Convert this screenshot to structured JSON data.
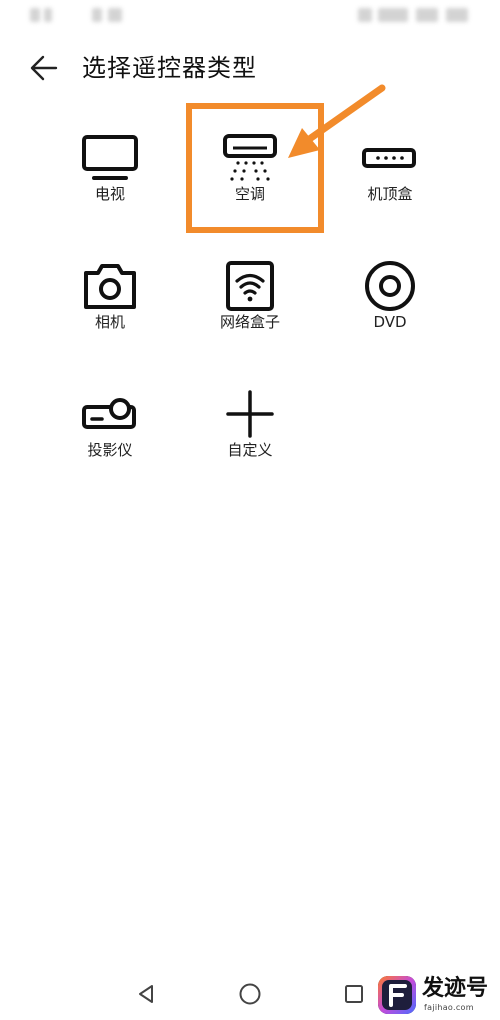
{
  "header": {
    "title": "选择遥控器类型",
    "back_icon": "arrow-left-icon"
  },
  "devices": [
    {
      "label": "电视",
      "icon": "tv-icon"
    },
    {
      "label": "空调",
      "icon": "air-conditioner-icon"
    },
    {
      "label": "机顶盒",
      "icon": "set-top-box-icon"
    },
    {
      "label": "相机",
      "icon": "camera-icon"
    },
    {
      "label": "网络盒子",
      "icon": "wifi-box-icon"
    },
    {
      "label": "DVD",
      "icon": "disc-icon"
    },
    {
      "label": "投影仪",
      "icon": "projector-icon"
    },
    {
      "label": "自定义",
      "icon": "plus-icon"
    }
  ],
  "annotation": {
    "color": "#f28b2b"
  },
  "nav_bar": {
    "back_icon": "triangle-back-icon",
    "home_icon": "circle-home-icon",
    "recents_icon": "square-recents-icon"
  },
  "watermark": {
    "name": "发迹号",
    "site": "fajihao.com"
  }
}
